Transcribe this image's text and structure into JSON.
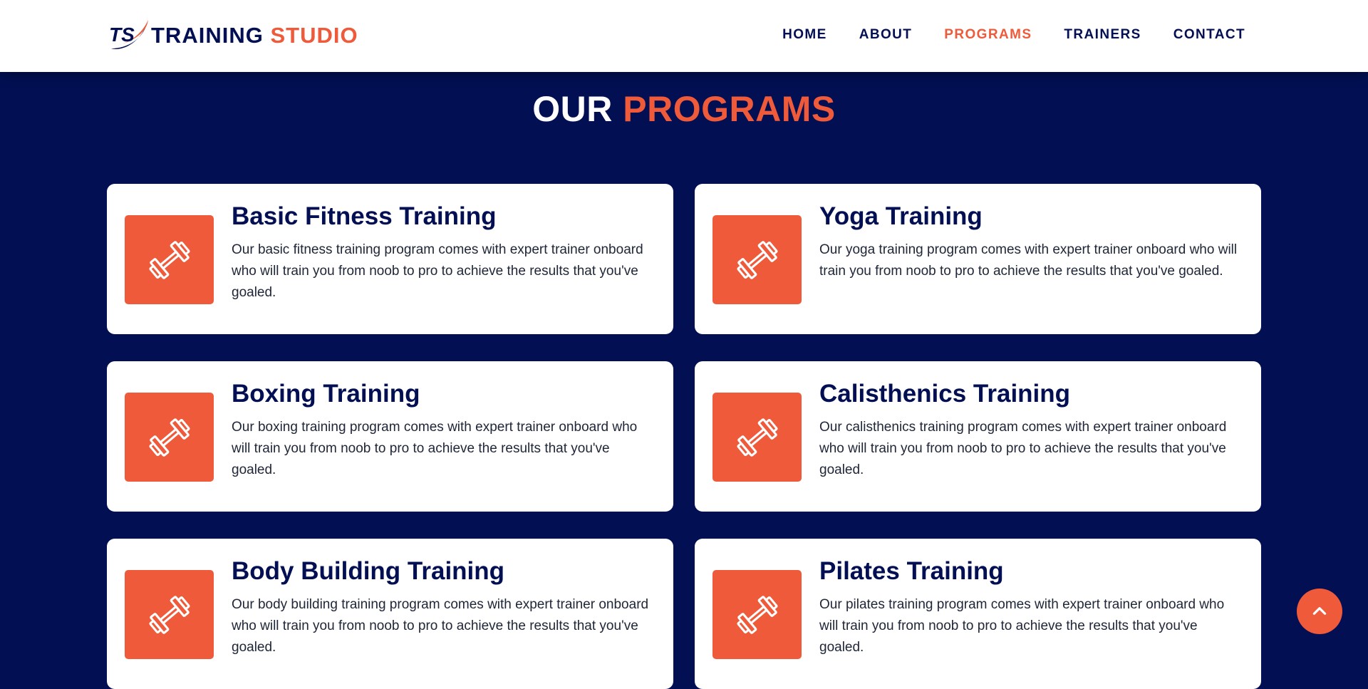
{
  "brand": {
    "mark": "TS",
    "name_part1": "TRAINING",
    "name_part2": "STUDIO"
  },
  "nav": {
    "items": [
      {
        "label": "HOME",
        "active": false
      },
      {
        "label": "ABOUT",
        "active": false
      },
      {
        "label": "PROGRAMS",
        "active": true
      },
      {
        "label": "TRAINERS",
        "active": false
      },
      {
        "label": "CONTACT",
        "active": false
      }
    ]
  },
  "section": {
    "title_part1": "OUR",
    "title_part2": "PROGRAMS"
  },
  "programs": [
    {
      "title": "Basic Fitness Training",
      "description": "Our basic fitness training program comes with expert trainer onboard who will train you from noob to pro to achieve the results that you've goaled.",
      "icon": "dumbbell-icon"
    },
    {
      "title": "Yoga Training",
      "description": "Our yoga training program comes with expert trainer onboard who will train you from noob to pro to achieve the results that you've goaled.",
      "icon": "dumbbell-icon"
    },
    {
      "title": "Boxing Training",
      "description": "Our boxing training program comes with expert trainer onboard who will train you from noob to pro to achieve the results that you've goaled.",
      "icon": "dumbbell-icon"
    },
    {
      "title": "Calisthenics Training",
      "description": "Our calisthenics training program comes with expert trainer onboard who will train you from noob to pro to achieve the results that you've goaled.",
      "icon": "dumbbell-icon"
    },
    {
      "title": "Body Building Training",
      "description": "Our body building training program comes with expert trainer onboard who will train you from noob to pro to achieve the results that you've goaled.",
      "icon": "dumbbell-icon"
    },
    {
      "title": "Pilates Training",
      "description": "Our pilates training program comes with expert trainer onboard who will train you from noob to pro to achieve the results that you've goaled.",
      "icon": "dumbbell-icon"
    }
  ],
  "scroll_top": {
    "icon": "chevron-up-icon"
  },
  "colors": {
    "navy": "#020f52",
    "accent": "#ee5a3a",
    "card_bg": "#ffffff"
  }
}
